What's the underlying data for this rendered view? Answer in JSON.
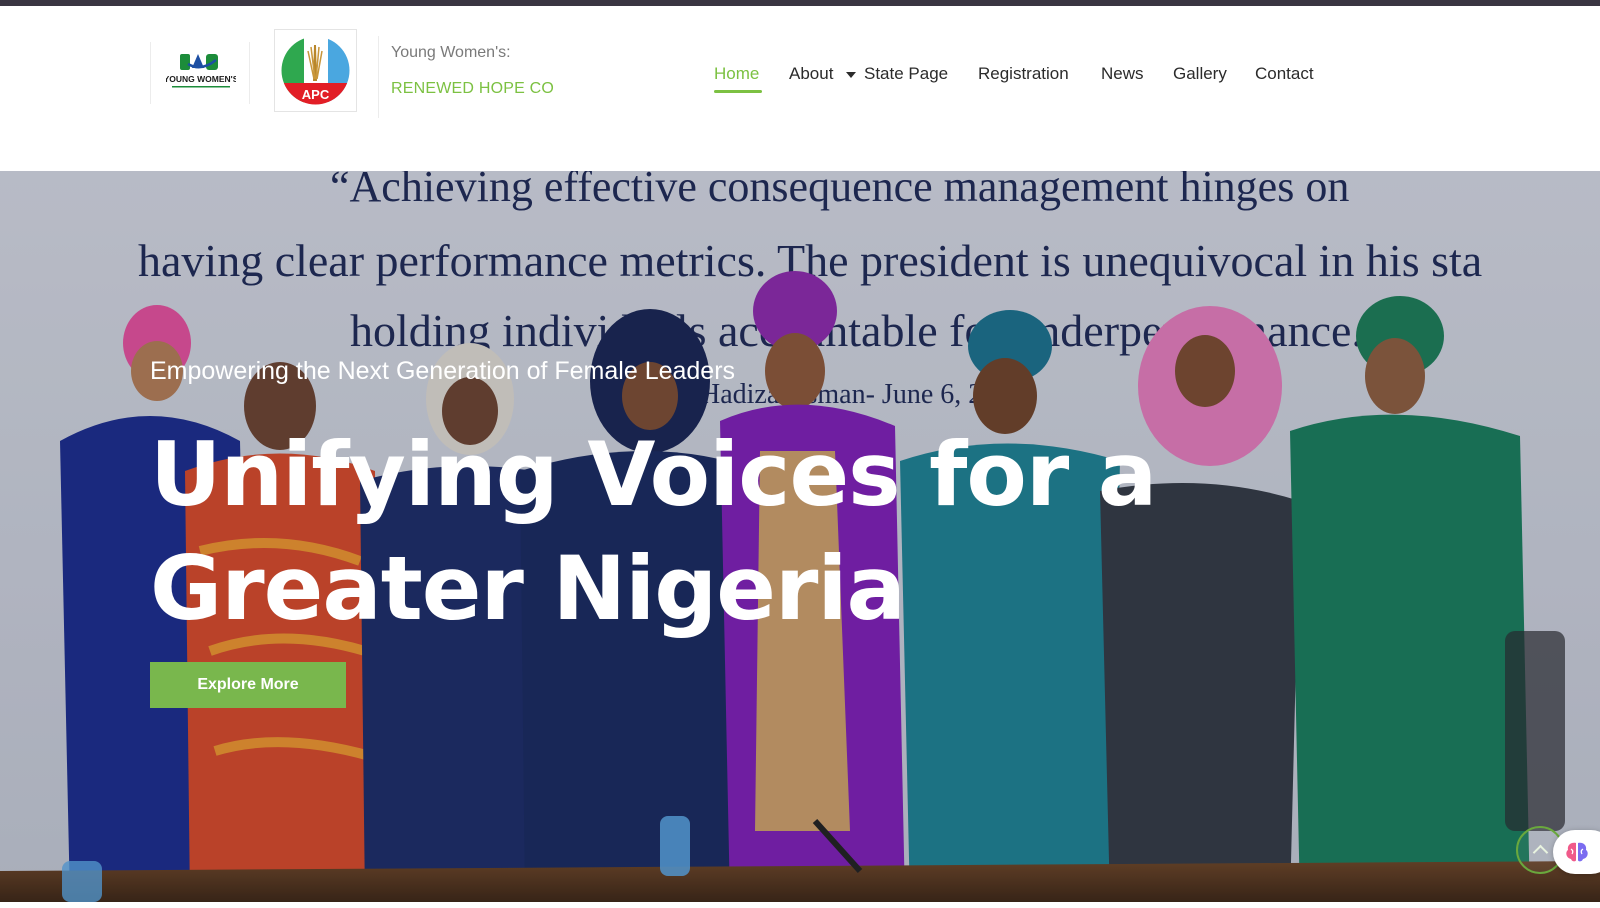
{
  "brand": {
    "logo1_text": "YOUNG WOMEN'S",
    "logo2_text": "APC",
    "line1": "Young Women's:",
    "line2": "RENEWED HOPE CO"
  },
  "nav": {
    "items": [
      {
        "label": "Home",
        "active": true
      },
      {
        "label": "About",
        "has_dropdown": true
      },
      {
        "label": "State Page"
      },
      {
        "label": "Registration"
      },
      {
        "label": "News"
      },
      {
        "label": "Gallery"
      },
      {
        "label": "Contact"
      }
    ]
  },
  "hero": {
    "subtitle": "Empowering the Next Generation of Female Leaders",
    "title": "Unifying Voices for a Greater Nigeria",
    "button_label": "Explore More",
    "wall_quote_line1": "“Achieving effective consequence management hinges on",
    "wall_quote_line2": "having clear performance metrics. The president is unequivocal in his sta",
    "wall_quote_line3": "holding individuals accountable for underperformance.”",
    "wall_quote_line4": "Hadiza Usman- June 6, 2024"
  },
  "colors": {
    "accent": "#7cc142",
    "button": "#79b74d",
    "top_strip": "#3a3542"
  },
  "icons": {
    "scroll_top": "chevron-up-icon",
    "widget": "brain-icon",
    "dropdown": "caret-down-icon"
  }
}
